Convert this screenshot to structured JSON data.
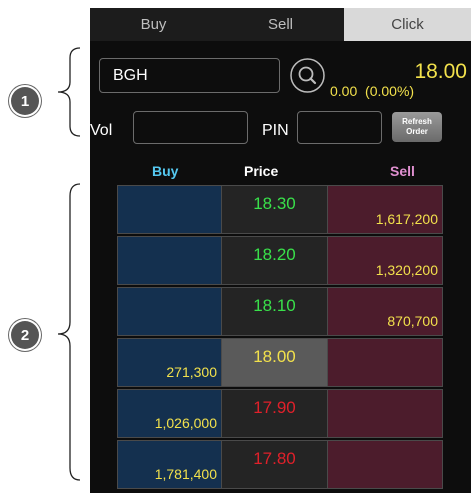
{
  "callouts": [
    {
      "num": "1"
    },
    {
      "num": "2"
    }
  ],
  "tabs": [
    {
      "label": "Buy"
    },
    {
      "label": "Sell"
    },
    {
      "label": "Click",
      "active": true
    }
  ],
  "symbol": {
    "value": "BGH"
  },
  "quote": {
    "last": "18.00",
    "change": "0.00",
    "pct": "(0.00%)"
  },
  "order": {
    "vol_label": "Vol",
    "vol_value": "",
    "pin_label": "PIN",
    "pin_value": "",
    "refresh_line1": "Refresh",
    "refresh_line2": "Order"
  },
  "book_header": {
    "buy": "Buy",
    "price": "Price",
    "sell": "Sell"
  },
  "book": [
    {
      "price": "18.30",
      "buy": "",
      "sell": "1,617,200",
      "color": "#39e04a"
    },
    {
      "price": "18.20",
      "buy": "",
      "sell": "1,320,200",
      "color": "#39e04a"
    },
    {
      "price": "18.10",
      "buy": "",
      "sell": "870,700",
      "color": "#39e04a"
    },
    {
      "price": "18.00",
      "buy": "271,300",
      "sell": "",
      "color": "#f2e14c",
      "current": true
    },
    {
      "price": "17.90",
      "buy": "1,026,000",
      "sell": "",
      "color": "#e0202a"
    },
    {
      "price": "17.80",
      "buy": "1,781,400",
      "sell": "",
      "color": "#e0202a"
    }
  ],
  "colors": {
    "accent_yellow": "#f2e14c",
    "buy_header": "#55c8f0",
    "sell_header": "#e090d0"
  }
}
